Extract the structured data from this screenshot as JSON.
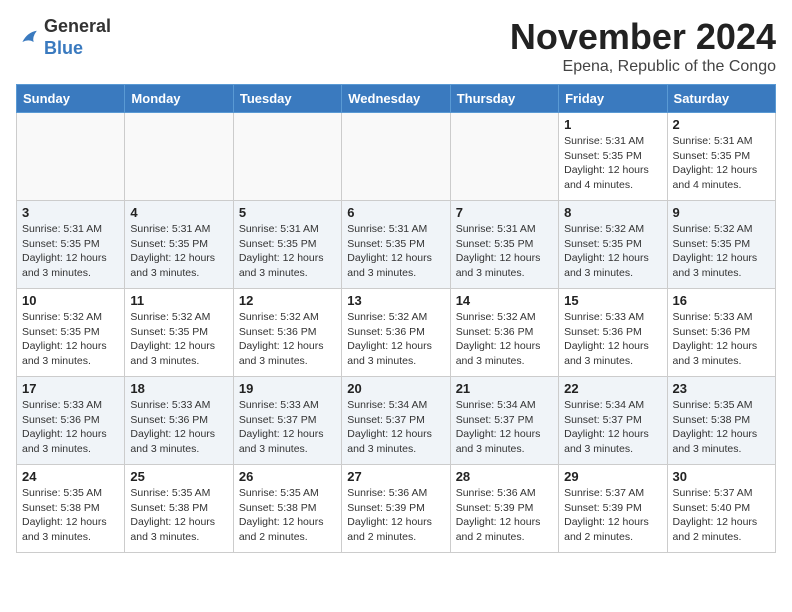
{
  "header": {
    "logo_line1": "General",
    "logo_line2": "Blue",
    "month_title": "November 2024",
    "location": "Epena, Republic of the Congo"
  },
  "weekdays": [
    "Sunday",
    "Monday",
    "Tuesday",
    "Wednesday",
    "Thursday",
    "Friday",
    "Saturday"
  ],
  "weeks": [
    [
      {
        "day": "",
        "info": ""
      },
      {
        "day": "",
        "info": ""
      },
      {
        "day": "",
        "info": ""
      },
      {
        "day": "",
        "info": ""
      },
      {
        "day": "",
        "info": ""
      },
      {
        "day": "1",
        "info": "Sunrise: 5:31 AM\nSunset: 5:35 PM\nDaylight: 12 hours\nand 4 minutes."
      },
      {
        "day": "2",
        "info": "Sunrise: 5:31 AM\nSunset: 5:35 PM\nDaylight: 12 hours\nand 4 minutes."
      }
    ],
    [
      {
        "day": "3",
        "info": "Sunrise: 5:31 AM\nSunset: 5:35 PM\nDaylight: 12 hours\nand 3 minutes."
      },
      {
        "day": "4",
        "info": "Sunrise: 5:31 AM\nSunset: 5:35 PM\nDaylight: 12 hours\nand 3 minutes."
      },
      {
        "day": "5",
        "info": "Sunrise: 5:31 AM\nSunset: 5:35 PM\nDaylight: 12 hours\nand 3 minutes."
      },
      {
        "day": "6",
        "info": "Sunrise: 5:31 AM\nSunset: 5:35 PM\nDaylight: 12 hours\nand 3 minutes."
      },
      {
        "day": "7",
        "info": "Sunrise: 5:31 AM\nSunset: 5:35 PM\nDaylight: 12 hours\nand 3 minutes."
      },
      {
        "day": "8",
        "info": "Sunrise: 5:32 AM\nSunset: 5:35 PM\nDaylight: 12 hours\nand 3 minutes."
      },
      {
        "day": "9",
        "info": "Sunrise: 5:32 AM\nSunset: 5:35 PM\nDaylight: 12 hours\nand 3 minutes."
      }
    ],
    [
      {
        "day": "10",
        "info": "Sunrise: 5:32 AM\nSunset: 5:35 PM\nDaylight: 12 hours\nand 3 minutes."
      },
      {
        "day": "11",
        "info": "Sunrise: 5:32 AM\nSunset: 5:35 PM\nDaylight: 12 hours\nand 3 minutes."
      },
      {
        "day": "12",
        "info": "Sunrise: 5:32 AM\nSunset: 5:36 PM\nDaylight: 12 hours\nand 3 minutes."
      },
      {
        "day": "13",
        "info": "Sunrise: 5:32 AM\nSunset: 5:36 PM\nDaylight: 12 hours\nand 3 minutes."
      },
      {
        "day": "14",
        "info": "Sunrise: 5:32 AM\nSunset: 5:36 PM\nDaylight: 12 hours\nand 3 minutes."
      },
      {
        "day": "15",
        "info": "Sunrise: 5:33 AM\nSunset: 5:36 PM\nDaylight: 12 hours\nand 3 minutes."
      },
      {
        "day": "16",
        "info": "Sunrise: 5:33 AM\nSunset: 5:36 PM\nDaylight: 12 hours\nand 3 minutes."
      }
    ],
    [
      {
        "day": "17",
        "info": "Sunrise: 5:33 AM\nSunset: 5:36 PM\nDaylight: 12 hours\nand 3 minutes."
      },
      {
        "day": "18",
        "info": "Sunrise: 5:33 AM\nSunset: 5:36 PM\nDaylight: 12 hours\nand 3 minutes."
      },
      {
        "day": "19",
        "info": "Sunrise: 5:33 AM\nSunset: 5:37 PM\nDaylight: 12 hours\nand 3 minutes."
      },
      {
        "day": "20",
        "info": "Sunrise: 5:34 AM\nSunset: 5:37 PM\nDaylight: 12 hours\nand 3 minutes."
      },
      {
        "day": "21",
        "info": "Sunrise: 5:34 AM\nSunset: 5:37 PM\nDaylight: 12 hours\nand 3 minutes."
      },
      {
        "day": "22",
        "info": "Sunrise: 5:34 AM\nSunset: 5:37 PM\nDaylight: 12 hours\nand 3 minutes."
      },
      {
        "day": "23",
        "info": "Sunrise: 5:35 AM\nSunset: 5:38 PM\nDaylight: 12 hours\nand 3 minutes."
      }
    ],
    [
      {
        "day": "24",
        "info": "Sunrise: 5:35 AM\nSunset: 5:38 PM\nDaylight: 12 hours\nand 3 minutes."
      },
      {
        "day": "25",
        "info": "Sunrise: 5:35 AM\nSunset: 5:38 PM\nDaylight: 12 hours\nand 3 minutes."
      },
      {
        "day": "26",
        "info": "Sunrise: 5:35 AM\nSunset: 5:38 PM\nDaylight: 12 hours\nand 2 minutes."
      },
      {
        "day": "27",
        "info": "Sunrise: 5:36 AM\nSunset: 5:39 PM\nDaylight: 12 hours\nand 2 minutes."
      },
      {
        "day": "28",
        "info": "Sunrise: 5:36 AM\nSunset: 5:39 PM\nDaylight: 12 hours\nand 2 minutes."
      },
      {
        "day": "29",
        "info": "Sunrise: 5:37 AM\nSunset: 5:39 PM\nDaylight: 12 hours\nand 2 minutes."
      },
      {
        "day": "30",
        "info": "Sunrise: 5:37 AM\nSunset: 5:40 PM\nDaylight: 12 hours\nand 2 minutes."
      }
    ]
  ]
}
